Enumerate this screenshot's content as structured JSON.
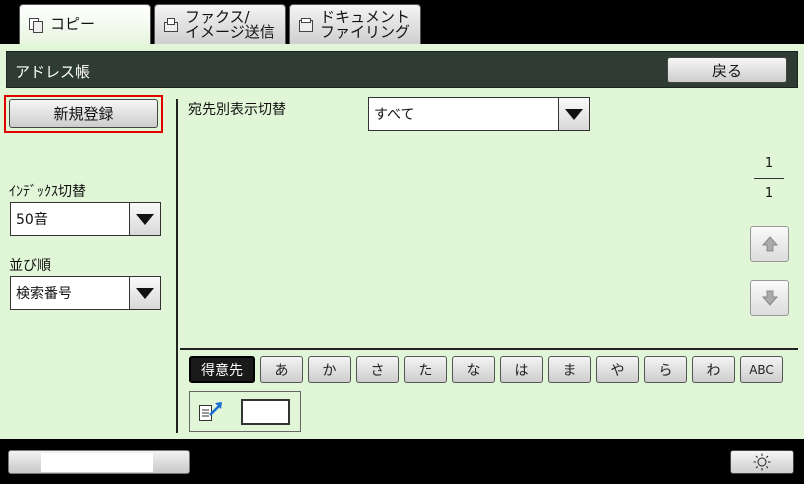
{
  "tabs": [
    {
      "label": "コピー",
      "icon": "copy-icon",
      "active": true
    },
    {
      "label": "ファクス/\nイメージ送信",
      "icon": "fax-icon",
      "active": false
    },
    {
      "label": "ドキュメント\nファイリング",
      "icon": "document-filing-icon",
      "active": false
    }
  ],
  "header": {
    "title": "アドレス帳",
    "back_label": "戻る"
  },
  "sidebar": {
    "new_register_label": "新規登録",
    "index_switch_label": "ｲﾝﾃﾞｯｸｽ切替",
    "index_switch_value": "50音",
    "sort_label": "並び順",
    "sort_value": "検索番号"
  },
  "main": {
    "filter_label": "宛先別表示切替",
    "filter_value": "すべて",
    "page_current": "1",
    "page_total": "1"
  },
  "index_tabs": [
    {
      "label": "得意先",
      "active": true
    },
    {
      "label": "あ"
    },
    {
      "label": "か"
    },
    {
      "label": "さ"
    },
    {
      "label": "た"
    },
    {
      "label": "な"
    },
    {
      "label": "は"
    },
    {
      "label": "ま"
    },
    {
      "label": "や"
    },
    {
      "label": "ら"
    },
    {
      "label": "わ"
    },
    {
      "label": "ABC"
    }
  ],
  "direct_entry": {
    "icon": "direct-address-entry-icon",
    "value": ""
  },
  "footer": {
    "brightness_icon": "brightness-icon"
  },
  "colors": {
    "panel": "#e1f5d7",
    "header": "#2e3c33",
    "highlight": "#e00000"
  }
}
